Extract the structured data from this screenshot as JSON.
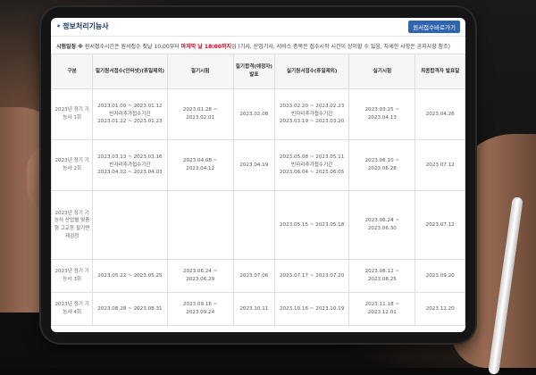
{
  "page": {
    "title": "정보처리기능사",
    "notice_button": "원서접수바로가기"
  },
  "notice": {
    "lead": "시험일정 ※",
    "text_before": " 원서접수시간은 원서접수 첫날 10:00부터 ",
    "deadline": "마지막 날 18:00까지",
    "text_after": "임 (기사, 산업기사, 서비스 종목은 접수시작 시간이 상이할 수 있음, 자세한 사항은 공지사항 참조)"
  },
  "table": {
    "headers": [
      "구분",
      "필기원서접수(인터넷)(휴일제외)",
      "필기시험",
      "필기합격(예정자)발표",
      "실기원서접수(휴일제외)",
      "실기시험",
      "최종합격자 발표일"
    ],
    "rows": [
      {
        "kind": "2023년 정기 기능사 1회",
        "written_reg": [
          "2023.01.09 ~ 2023.01.12",
          "빈자리추가접수기간",
          "2023.01.22 ~ 2023.01.23"
        ],
        "written_exam": "2023.01.28 ~ 2023.02.01",
        "written_pass": "2023.02.08",
        "practical_reg": [
          "2023.02.20 ~ 2023.02.23",
          "빈자리추가접수기간",
          "2023.03.19 ~ 2023.03.20"
        ],
        "practical_exam": "2023.03.25 ~ 2023.04.13",
        "final_pass": "2023.04.26"
      },
      {
        "kind": "2023년 정기 기능사 2회",
        "written_reg": [
          "2023.03.13 ~ 2023.03.16",
          "빈자리추가접수기간",
          "2023.04.02 ~ 2023.04.03"
        ],
        "written_exam": "2023.04.08 ~ 2023.04.12",
        "written_pass": "2023.04.19",
        "practical_reg": [
          "2023.05.08 ~ 2023.05.11",
          "빈자리추가접수기간",
          "2023.06.04 ~ 2023.06.05"
        ],
        "practical_exam": "2023.06.10 ~ 2023.06.28",
        "final_pass": "2023.07.12"
      },
      {
        "kind": "2023년 정기 기능사 산업별 맞춤형 고교등 필기면제검정",
        "written_reg": [],
        "written_exam": "",
        "written_pass": "",
        "practical_reg": [
          "2023.05.15 ~ 2023.05.18"
        ],
        "practical_exam": "2023.06.24 ~ 2023.06.30",
        "final_pass": "2023.07.12"
      },
      {
        "kind": "2023년 정기 기능사 3회",
        "written_reg": [
          "2023.05.22 ~ 2023.05.25"
        ],
        "written_exam": "2023.06.24 ~ 2023.06.29",
        "written_pass": "2023.07.06",
        "practical_reg": [
          "2023.07.17 ~ 2023.07.20"
        ],
        "practical_exam": "2023.08.12 ~ 2023.08.25",
        "final_pass": "2023.09.20"
      },
      {
        "kind": "2023년 정기 기능사 4회",
        "written_reg": [
          "2023.08.28 ~ 2023.08.31"
        ],
        "written_exam": "2023.09.16 ~ 2023.09.24",
        "written_pass": "2023.10.11",
        "practical_reg": [
          "2023.10.16 ~ 2023.10.19"
        ],
        "practical_exam": "2023.11.18 ~ 2023.12.01",
        "final_pass": "2023.12.20"
      }
    ]
  }
}
